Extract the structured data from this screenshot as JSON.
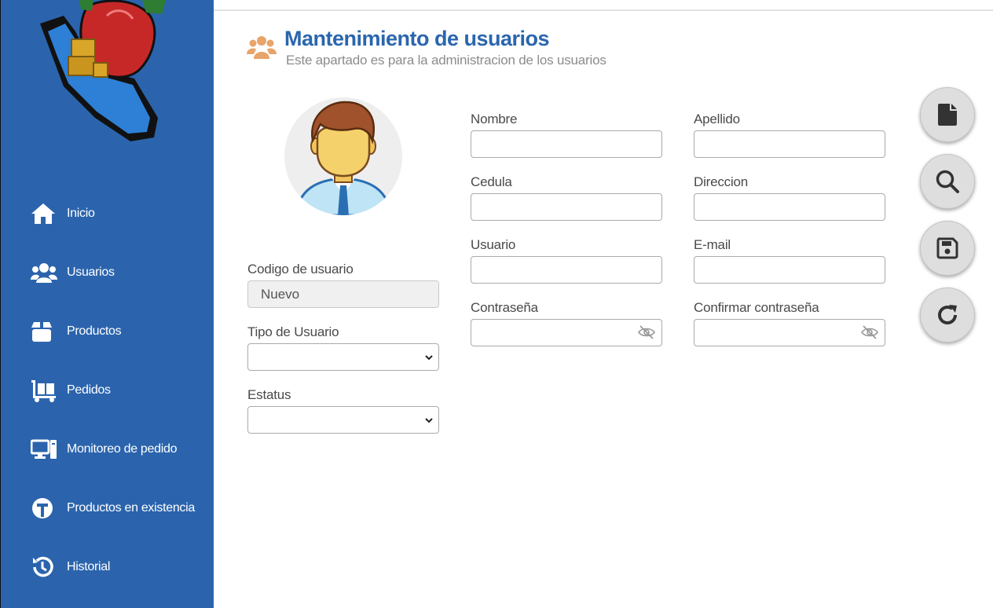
{
  "sidebar": {
    "items": [
      {
        "label": "Inicio",
        "icon": "home-icon"
      },
      {
        "label": "Usuarios",
        "icon": "users-icon"
      },
      {
        "label": "Productos",
        "icon": "box-icon"
      },
      {
        "label": "Pedidos",
        "icon": "dolly-icon"
      },
      {
        "label": "Monitoreo de pedido",
        "icon": "desktop-icon"
      },
      {
        "label": "Productos en existencia",
        "icon": "stock-icon"
      },
      {
        "label": "Historial",
        "icon": "history-icon"
      }
    ]
  },
  "header": {
    "title": "Mantenimiento de usuarios",
    "subtitle": "Este apartado es para la administracion de los usuarios",
    "icon": "users-icon"
  },
  "form": {
    "codigo_label": "Codigo de usuario",
    "codigo_value": "Nuevo",
    "tipo_label": "Tipo de Usuario",
    "estatus_label": "Estatus",
    "nombre_label": "Nombre",
    "apellido_label": "Apellido",
    "cedula_label": "Cedula",
    "direccion_label": "Direccion",
    "usuario_label": "Usuario",
    "email_label": "E-mail",
    "contrasena_label": "Contraseña",
    "confirmar_label": "Confirmar contraseña"
  },
  "actions": [
    "new-file-icon",
    "search-icon",
    "save-icon",
    "refresh-icon"
  ],
  "colors": {
    "sidebar": "#2b64ad",
    "title": "#2a66ad",
    "accent_icon": "#e8a46a",
    "button_bg": "#dedede"
  }
}
